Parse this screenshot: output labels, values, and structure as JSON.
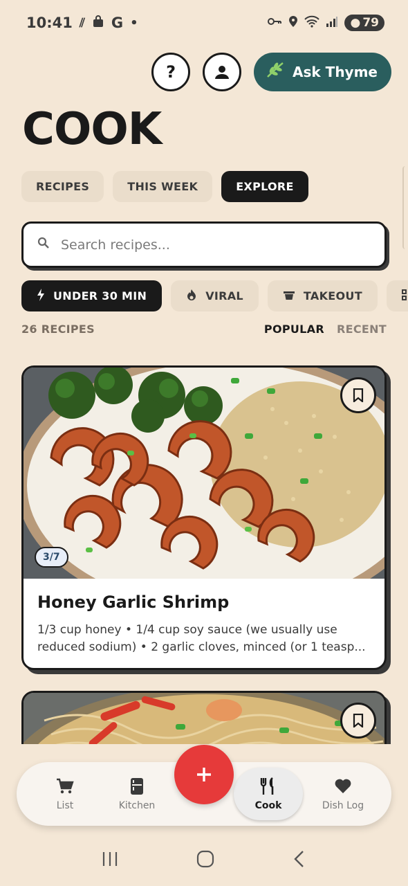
{
  "status_bar": {
    "time": "10:41",
    "carrier_letter": "G",
    "battery": "79",
    "icons": [
      "hash-icon",
      "bag-icon",
      "key-icon",
      "location-icon",
      "wifi-icon",
      "signal-icon"
    ]
  },
  "header": {
    "help_label": "?",
    "ask_label": "Ask Thyme",
    "title": "COOK"
  },
  "tabs": [
    {
      "label": "RECIPES",
      "active": false
    },
    {
      "label": "THIS WEEK",
      "active": false
    },
    {
      "label": "EXPLORE",
      "active": true
    }
  ],
  "search": {
    "placeholder": "Search recipes..."
  },
  "filters": [
    {
      "label": "UNDER 30 MIN",
      "icon": "bolt-icon",
      "active": true
    },
    {
      "label": "VIRAL",
      "icon": "flame-icon",
      "active": false
    },
    {
      "label": "TAKEOUT",
      "icon": "takeout-icon",
      "active": false
    },
    {
      "label": "",
      "icon": "grid-icon",
      "active": false
    }
  ],
  "results": {
    "count": "26 RECIPES",
    "sort_popular": "POPULAR",
    "sort_recent": "RECENT"
  },
  "cards": [
    {
      "title": "Honey Garlic Shrimp",
      "desc": "1/3 cup honey • 1/4 cup soy sauce (we usually use reduced sodium) • 2 garlic cloves, minced (or 1 teasp...",
      "pager": "3/7"
    }
  ],
  "bottom_nav": {
    "list": "List",
    "kitchen": "Kitchen",
    "cook": "Cook",
    "dish_log": "Dish Log"
  },
  "colors": {
    "background": "#f4e7d6",
    "accent_teal": "#2a5e5e",
    "fab_red": "#e63a3a",
    "dark": "#1a1a1a"
  }
}
